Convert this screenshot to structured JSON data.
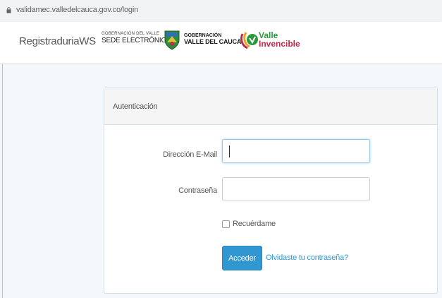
{
  "browser": {
    "url": "validamec.valledelcauca.gov.co/login",
    "lock_icon": "lock-icon"
  },
  "navbar": {
    "brand": "RegistraduriaWS",
    "logo_gobernacion_small": {
      "line1": "GOBERNACIÓN DEL VALLE",
      "line2": "SEDE ELECTRÓNICA"
    },
    "logo_gobernacion_big": {
      "line1": "GOBERNACIÓN",
      "line2": "VALLE DEL CAUCA"
    },
    "logo_valle": {
      "line1": "Valle",
      "line2": "Invencible"
    }
  },
  "card": {
    "title": "Autenticación",
    "email_label": "Dirección E-Mail",
    "email_value": "",
    "password_label": "Contraseña",
    "password_value": "",
    "remember_label": "Recuérdame",
    "remember_checked": false,
    "submit_label": "Acceder",
    "forgot_label": "Olvidaste tu contraseña?"
  },
  "colors": {
    "primary": "#3097d1",
    "link": "#3097d1",
    "page_bg": "#f5f8fa",
    "valle_green": "#2a9a3a",
    "valle_red": "#c0294a"
  }
}
